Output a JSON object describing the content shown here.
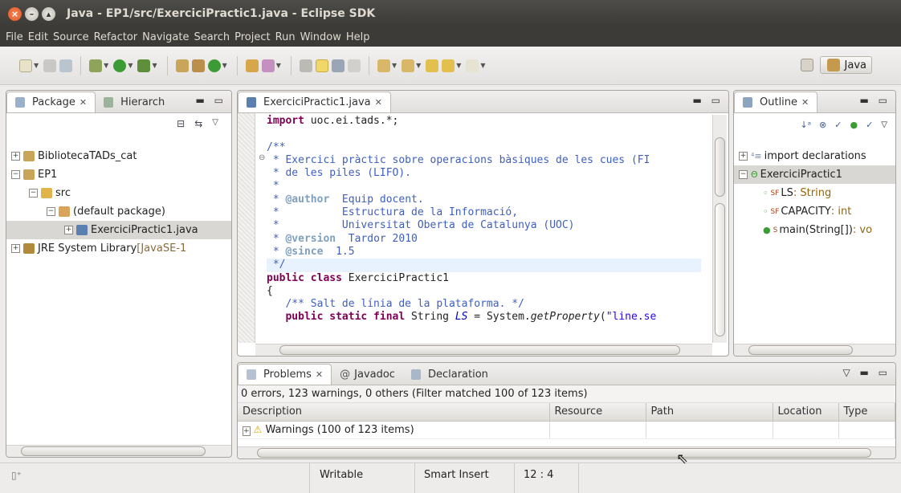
{
  "window": {
    "title": "Java - EP1/src/ExerciciPractic1.java - Eclipse SDK"
  },
  "menu": [
    "File",
    "Edit",
    "Source",
    "Refactor",
    "Navigate",
    "Search",
    "Project",
    "Run",
    "Window",
    "Help"
  ],
  "perspective": {
    "label": "Java"
  },
  "package_explorer": {
    "tabs": [
      "Package",
      "Hierarch"
    ],
    "items": [
      {
        "label": "BibliotecaTADs_cat",
        "expander": "+",
        "depth": 0
      },
      {
        "label": "EP1",
        "expander": "−",
        "depth": 0
      },
      {
        "label": "src",
        "expander": "−",
        "depth": 1
      },
      {
        "label": "(default package)",
        "expander": "−",
        "depth": 2
      },
      {
        "label": "ExerciciPractic1.java",
        "expander": "+",
        "depth": 3,
        "selected": true
      },
      {
        "label": "JRE System Library",
        "suffix": "[JavaSE-1",
        "expander": "+",
        "depth": 0
      }
    ]
  },
  "editor": {
    "tab": "ExerciciPractic1.java",
    "lines": [
      [
        {
          "t": "import",
          "c": "kw"
        },
        {
          "t": " uoc.ei.tads.*;"
        }
      ],
      [
        {
          "t": ""
        }
      ],
      [
        {
          "t": "/**",
          "c": "cm"
        }
      ],
      [
        {
          "t": " * Exercici pràctic sobre operacions bàsiques de les cues (FI",
          "c": "cm"
        }
      ],
      [
        {
          "t": " * de les piles (LIFO).",
          "c": "cm"
        }
      ],
      [
        {
          "t": " *",
          "c": "cm"
        }
      ],
      [
        {
          "t": " * ",
          "c": "cm"
        },
        {
          "t": "@author",
          "c": "tag"
        },
        {
          "t": "  Equip docent.",
          "c": "cm"
        }
      ],
      [
        {
          "t": " *          Estructura de la Informació,",
          "c": "cm"
        }
      ],
      [
        {
          "t": " *          Universitat Oberta de Catalunya (UOC)",
          "c": "cm"
        }
      ],
      [
        {
          "t": " * ",
          "c": "cm"
        },
        {
          "t": "@version",
          "c": "tag"
        },
        {
          "t": "  Tardor 2010",
          "c": "cm"
        }
      ],
      [
        {
          "t": " * ",
          "c": "cm"
        },
        {
          "t": "@since",
          "c": "tag"
        },
        {
          "t": "  1.5",
          "c": "cm"
        }
      ],
      [
        {
          "t": " */",
          "c": "cm"
        }
      ],
      [
        {
          "t": "public class",
          "c": "kw"
        },
        {
          "t": " ExerciciPractic1"
        }
      ],
      [
        {
          "t": "{"
        }
      ],
      [
        {
          "t": "   /** Salt de línia de la plataforma. */",
          "c": "cm"
        }
      ],
      [
        {
          "t": "   "
        },
        {
          "t": "public static final",
          "c": "kw"
        },
        {
          "t": " String "
        },
        {
          "t": "LS",
          "c": "fld"
        },
        {
          "t": " = System."
        },
        {
          "t": "getProperty",
          "c": "it"
        },
        {
          "t": "("
        },
        {
          "t": "\"line.se",
          "c": "st"
        }
      ]
    ]
  },
  "outline": {
    "tab": "Outline",
    "items": [
      {
        "label": "import declarations",
        "expander": "+",
        "depth": 0
      },
      {
        "label": "ExerciciPractic1",
        "expander": "−",
        "depth": 0,
        "selected": true
      },
      {
        "label": "LS",
        "type": " : String",
        "mods": "SF",
        "depth": 1
      },
      {
        "label": "CAPACITY",
        "type": " : int",
        "mods": "SF",
        "depth": 1
      },
      {
        "label": "main(String[])",
        "type": " : vo",
        "mods": "S",
        "depth": 1
      }
    ]
  },
  "problems": {
    "tabs": [
      "Problems",
      "Javadoc",
      "Declaration"
    ],
    "summary": "0 errors, 123 warnings, 0 others (Filter matched 100 of 123 items)",
    "columns": [
      "Description",
      "Resource",
      "Path",
      "Location",
      "Type"
    ],
    "rows": [
      {
        "description": "Warnings (100 of 123 items)"
      }
    ]
  },
  "statusbar": {
    "writable": "Writable",
    "insert_mode": "Smart Insert",
    "position": "12 : 4"
  },
  "colors": {
    "titlebar": "#3c3b37",
    "accent": "#e0541f"
  }
}
